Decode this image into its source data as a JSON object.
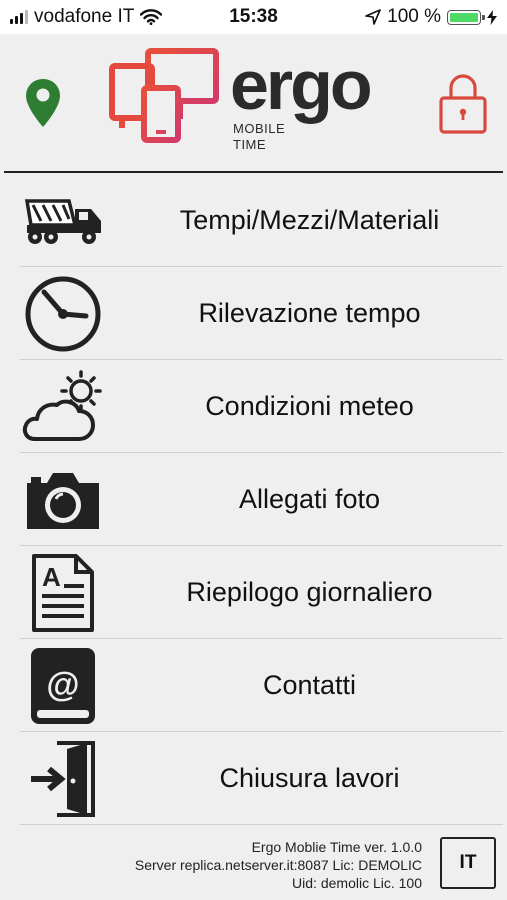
{
  "status_bar": {
    "carrier": "vodafone IT",
    "time": "15:38",
    "battery_text": "100 %",
    "battery_level": 1.0,
    "signal_bars_active": 3,
    "signal_bars_total": 4
  },
  "header": {
    "logo_word": "ergo",
    "logo_sub_line1": "MOBILE",
    "logo_sub_line2": "TIME",
    "logo_color": "#e5483c",
    "pin_color": "#2e7d32",
    "lock_color": "#d84a3f"
  },
  "menu": {
    "items": [
      {
        "label": "Tempi/Mezzi/Materiali",
        "icon": "truck-icon"
      },
      {
        "label": "Rilevazione tempo",
        "icon": "clock-icon"
      },
      {
        "label": "Condizioni meteo",
        "icon": "weather-icon"
      },
      {
        "label": "Allegati foto",
        "icon": "camera-icon"
      },
      {
        "label": "Riepilogo giornaliero",
        "icon": "document-icon"
      },
      {
        "label": "Contatti",
        "icon": "address-book-icon"
      },
      {
        "label": "Chiusura lavori",
        "icon": "exit-door-icon"
      }
    ]
  },
  "footer": {
    "version": "Ergo Moblie Time ver. 1.0.0",
    "server": "Server replica.netserver.it:8087 Lic: DEMOLIC",
    "uid": "Uid: demolic Lic. 100",
    "language": "IT"
  }
}
